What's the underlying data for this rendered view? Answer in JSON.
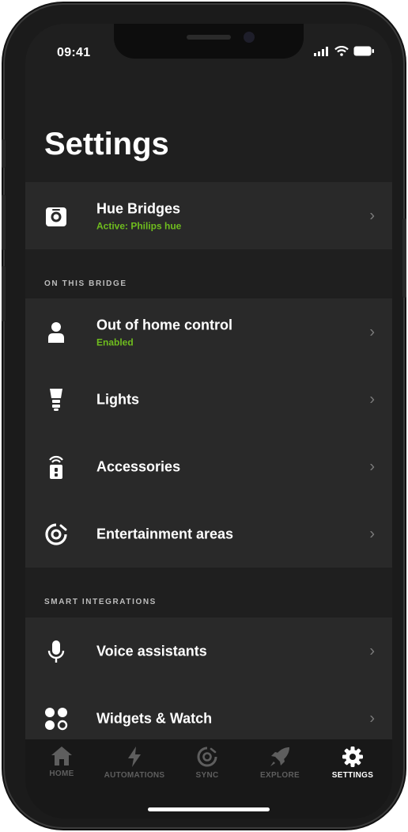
{
  "status": {
    "time": "09:41"
  },
  "page": {
    "title": "Settings"
  },
  "bridges": {
    "title": "Hue Bridges",
    "subtitle": "Active: Philips hue",
    "icon": "bridge-icon"
  },
  "on_this_bridge": {
    "header": "ON THIS BRIDGE",
    "items": [
      {
        "label": "Out of home control",
        "subtitle": "Enabled",
        "icon": "person-icon"
      },
      {
        "label": "Lights",
        "icon": "bulb-icon"
      },
      {
        "label": "Accessories",
        "icon": "accessory-icon"
      },
      {
        "label": "Entertainment areas",
        "icon": "entertainment-icon"
      }
    ]
  },
  "smart_integrations": {
    "header": "SMART INTEGRATIONS",
    "items": [
      {
        "label": "Voice assistants",
        "icon": "microphone-icon"
      },
      {
        "label": "Widgets & Watch",
        "icon": "widgets-icon"
      }
    ]
  },
  "tabbar": {
    "tabs": [
      {
        "label": "HOME",
        "icon": "home-icon",
        "active": false
      },
      {
        "label": "AUTOMATIONS",
        "icon": "lightning-icon",
        "active": false
      },
      {
        "label": "SYNC",
        "icon": "sync-icon",
        "active": false
      },
      {
        "label": "EXPLORE",
        "icon": "rocket-icon",
        "active": false
      },
      {
        "label": "SETTINGS",
        "icon": "gear-icon",
        "active": true
      }
    ]
  },
  "colors": {
    "accent_green": "#6fbd1e",
    "background": "#1f1f1f",
    "row_background": "#292929"
  }
}
